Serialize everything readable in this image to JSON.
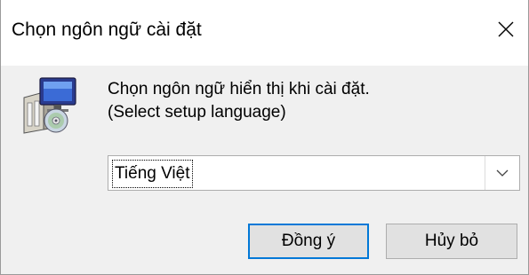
{
  "window": {
    "title": "Chọn ngôn ngữ cài đặt",
    "close_icon": "close-icon"
  },
  "icon": "setup-installer-icon",
  "message": {
    "line1": "Chọn ngôn ngữ hiển thị khi cài đặt.",
    "line2": "(Select setup language)"
  },
  "language_select": {
    "selected": "Tiếng Việt",
    "arrow_icon": "chevron-down-icon"
  },
  "buttons": {
    "ok_label": "Đồng ý",
    "cancel_label": "Hủy bỏ"
  },
  "colors": {
    "dialog_bg": "#f0f0f0",
    "title_bg": "#ffffff",
    "default_button_border": "#0078d7"
  }
}
